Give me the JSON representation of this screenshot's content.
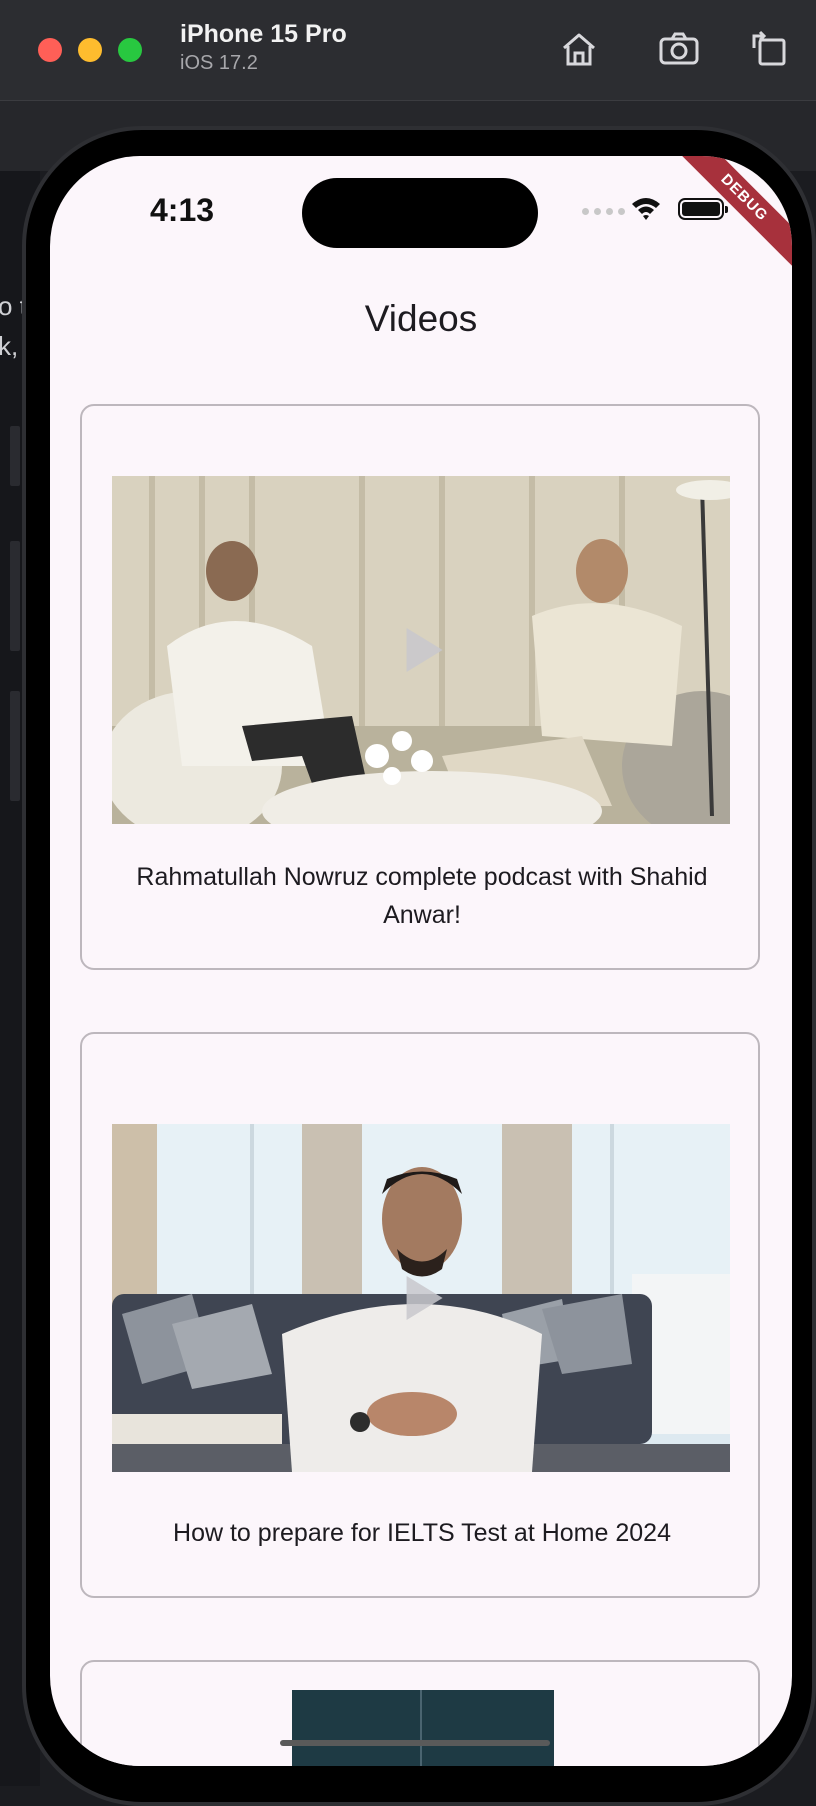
{
  "simulator": {
    "device_name": "iPhone 15 Pro",
    "os_version": "iOS 17.2",
    "toolbar": {
      "home_icon": "home-icon",
      "screenshot_icon": "camera-icon",
      "rotate_icon": "rotate-icon"
    }
  },
  "background_window": {
    "fragments": [
      "o t",
      "k,"
    ]
  },
  "status_bar": {
    "time": "4:13",
    "debug_banner": "DEBUG"
  },
  "app": {
    "title": "Videos",
    "videos": [
      {
        "caption": "Rahmatullah Nowruz complete podcast with Shahid Anwar!"
      },
      {
        "caption": "How to prepare for IELTS Test at Home 2024"
      },
      {
        "caption": ""
      }
    ]
  },
  "colors": {
    "screen_background": "#fcf6fb",
    "card_border": "#bdb7bd",
    "debug_banner": "#a7313c"
  }
}
